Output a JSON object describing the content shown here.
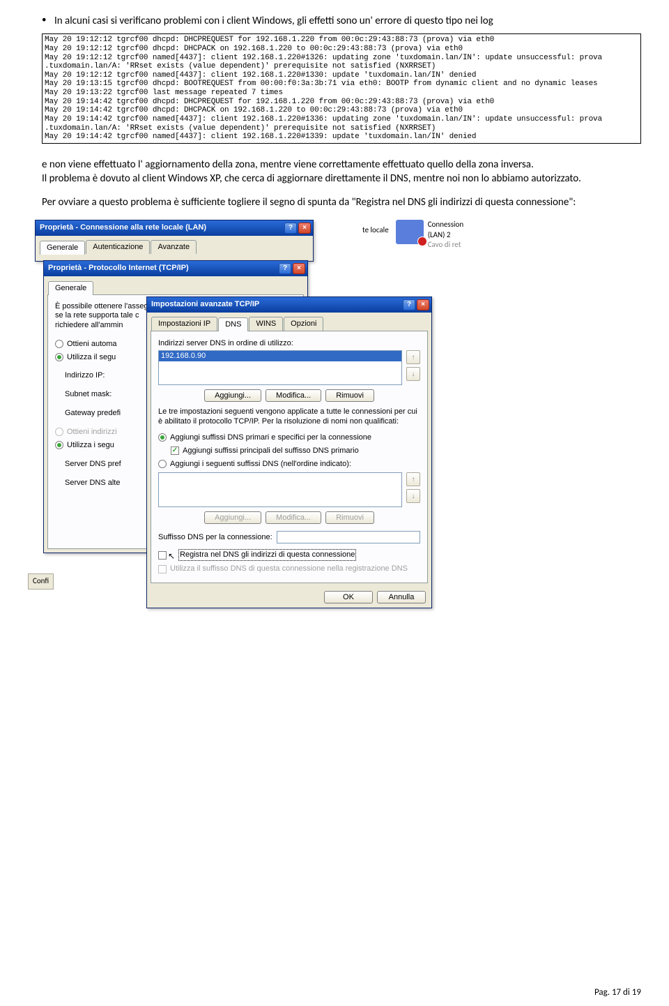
{
  "intro": {
    "bullet": "•",
    "text": "In alcuni casi si verificano problemi con i client Windows, gli effetti sono un' errore di questo tipo nei log"
  },
  "log": "May 20 19:12:12 tgrcf00 dhcpd: DHCPREQUEST for 192.168.1.220 from 00:0c:29:43:88:73 (prova) via eth0\nMay 20 19:12:12 tgrcf00 dhcpd: DHCPACK on 192.168.1.220 to 00:0c:29:43:88:73 (prova) via eth0\nMay 20 19:12:12 tgrcf00 named[4437]: client 192.168.1.220#1326: updating zone 'tuxdomain.lan/IN': update unsuccessful: prova\n.tuxdomain.lan/A: 'RRset exists (value dependent)' prerequisite not satisfied (NXRRSET)\nMay 20 19:12:12 tgrcf00 named[4437]: client 192.168.1.220#1330: update 'tuxdomain.lan/IN' denied\nMay 20 19:13:15 tgrcf00 dhcpd: BOOTREQUEST from 00:00:f0:3a:3b:71 via eth0: BOOTP from dynamic client and no dynamic leases\nMay 20 19:13:22 tgrcf00 last message repeated 7 times\nMay 20 19:14:42 tgrcf00 dhcpd: DHCPREQUEST for 192.168.1.220 from 00:0c:29:43:88:73 (prova) via eth0\nMay 20 19:14:42 tgrcf00 dhcpd: DHCPACK on 192.168.1.220 to 00:0c:29:43:88:73 (prova) via eth0\nMay 20 19:14:42 tgrcf00 named[4437]: client 192.168.1.220#1336: updating zone 'tuxdomain.lan/IN': update unsuccessful: prova\n.tuxdomain.lan/A: 'RRset exists (value dependent)' prerequisite not satisfied (NXRRSET)\nMay 20 19:14:42 tgrcf00 named[4437]: client 192.168.1.220#1339: update 'tuxdomain.lan/IN' denied",
  "para1": "e non viene effettuato l' aggiornamento della zona, mentre viene correttamente effettuato quello della zona inversa.\nIl problema è dovuto al client Windows XP, che cerca di aggiornare direttamente il DNS, mentre noi non lo abbiamo autorizzato.",
  "para2": "Per ovviare a questo problema è sufficiente togliere il segno di spunta da \"Registra nel DNS gli indirizzi di questa connessione\":",
  "bg": {
    "te_locale": "te locale",
    "conn": "Connession",
    "lan2": "(LAN) 2",
    "cavo": "Cavo di ret",
    "conf": "Confi"
  },
  "win1": {
    "title": "Proprietà - Connessione alla rete locale (LAN)",
    "tabs": [
      "Generale",
      "Autenticazione",
      "Avanzate"
    ]
  },
  "win2": {
    "title": "Proprietà - Protocollo Internet (TCP/IP)",
    "tab": "Generale",
    "desc": "È possibile ottenere l'assegnazione automatica delle impostazioni IP se la rete supporta tale c\nrichiedere all'ammin",
    "r1": "Ottieni automa",
    "r2": "Utilizza il segu",
    "ip": "Indirizzo IP:",
    "mask": "Subnet mask:",
    "gw": "Gateway predefi",
    "r3": "Ottieni indirizzi",
    "r4": "Utilizza i segu",
    "dns1": "Server DNS pref",
    "dns2": "Server DNS alte"
  },
  "win3": {
    "title": "Impostazioni avanzate TCP/IP",
    "tabs": [
      "Impostazioni IP",
      "DNS",
      "WINS",
      "Opzioni"
    ],
    "l_order": "Indirizzi server DNS in ordine di utilizzo:",
    "dns_entry": "192.168.0.90",
    "btn_add": "Aggiungi...",
    "btn_mod": "Modifica...",
    "btn_rem": "Rimuovi",
    "desc3": "Le tre impostazioni seguenti vengono applicate a tutte le connessioni per cui è abilitato il protocollo TCP/IP. Per la risoluzione di nomi non qualificati:",
    "r_a": "Aggiungi suffissi DNS primari e specifici per la connessione",
    "chk_a": "Aggiungi suffissi principali del suffisso DNS primario",
    "r_b": "Aggiungi i seguenti suffissi DNS (nell'ordine indicato):",
    "l_suffix": "Suffisso DNS per la connessione:",
    "chk_reg": "Registra nel DNS gli indirizzi di questa connessione",
    "chk_use": "Utilizza il suffisso DNS di questa connessione nella registrazione DNS",
    "ok": "OK",
    "cancel": "Annulla"
  },
  "footer": "Pag. 17 di 19"
}
